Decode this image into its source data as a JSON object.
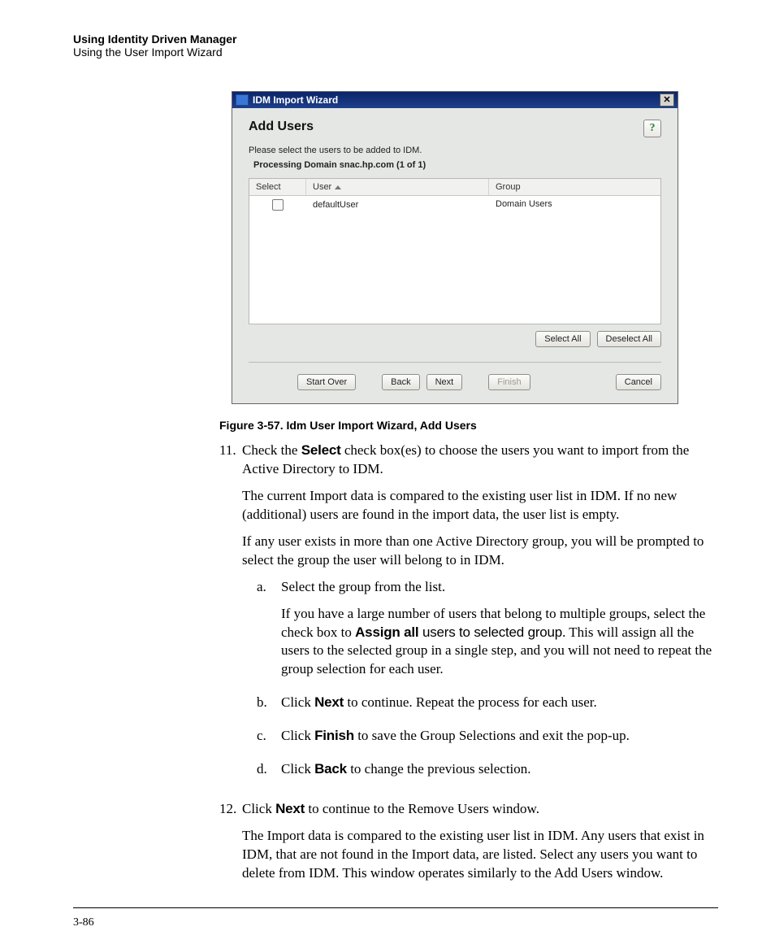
{
  "header": {
    "title": "Using Identity Driven Manager",
    "subtitle": "Using the User Import Wizard"
  },
  "dialog": {
    "window_title": "IDM Import Wizard",
    "heading": "Add Users",
    "instruction": "Please select the users to be added to IDM.",
    "status": "Processing Domain snac.hp.com (1 of 1)",
    "columns": {
      "select": "Select",
      "user": "User",
      "group": "Group"
    },
    "rows": [
      {
        "user": "defaultUser",
        "group": "Domain Users"
      }
    ],
    "buttons": {
      "select_all": "Select All",
      "deselect_all": "Deselect All",
      "start_over": "Start Over",
      "back": "Back",
      "next": "Next",
      "finish": "Finish",
      "cancel": "Cancel"
    }
  },
  "caption": "Figure 3-57. Idm User Import Wizard, Add Users",
  "steps": {
    "s11": {
      "num": "11.",
      "p1a": "Check the ",
      "p1b": "Select",
      "p1c": " check box(es) to choose the users you want to import from the Active Directory to IDM.",
      "p2": "The current Import data is compared to the existing user list in IDM. If no new (additional) users are found in the import data, the user list is empty.",
      "p3": "If any user exists in more than one Active Directory group, you will be prompted to select the group the user will belong to in IDM.",
      "a": {
        "letter": "a.",
        "l1": "Select the group from the list.",
        "l2a": "If you have a large number of users that belong to multiple groups, select the check box to ",
        "l2b": "Assign all",
        "l2c": " users to selected group",
        "l2d": ". This will assign all the users to the selected group in a single step, and you will not need to repeat the group selection for each user."
      },
      "b": {
        "letter": "b.",
        "t1": "Click ",
        "t2": "Next",
        "t3": " to continue. Repeat the process for each user."
      },
      "c": {
        "letter": "c.",
        "t1": "Click ",
        "t2": "Finish",
        "t3": " to save the Group Selections and exit the pop-up."
      },
      "d": {
        "letter": "d.",
        "t1": "Click ",
        "t2": "Back",
        "t3": " to change the previous selection."
      }
    },
    "s12": {
      "num": "12.",
      "p1a": "Click ",
      "p1b": "Next",
      "p1c": " to continue to the Remove Users window.",
      "p2": "The Import data is compared to the existing user list in IDM. Any users that exist in IDM, that are not found in the Import data, are listed. Select any users you want to delete from IDM. This window operates similarly to the Add Users window."
    }
  },
  "page_number": "3-86"
}
